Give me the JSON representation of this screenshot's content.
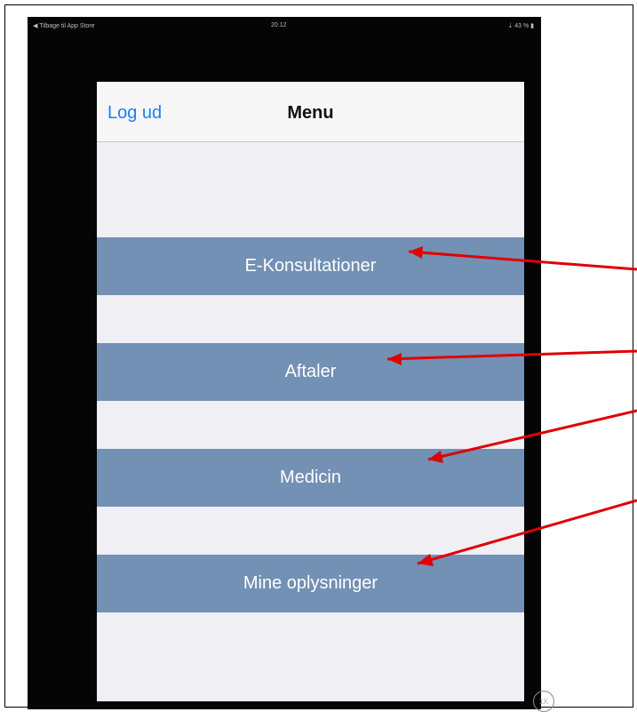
{
  "status_bar": {
    "carrier": "◀ Tilbage til App Store",
    "time": "20.12",
    "battery": "⇣ 43 % ▮"
  },
  "navbar": {
    "logout": "Log ud",
    "title": "Menu"
  },
  "menu": {
    "items": [
      {
        "label": "E-Konsultationer"
      },
      {
        "label": "Aftaler"
      },
      {
        "label": "Medicin"
      },
      {
        "label": "Mine oplysninger"
      }
    ]
  },
  "overlay": {
    "zoom_badge": "1X"
  },
  "colors": {
    "button": "#7390b5",
    "screen_bg": "#efeff4",
    "link": "#1f7bff",
    "arrow": "#e00000"
  }
}
